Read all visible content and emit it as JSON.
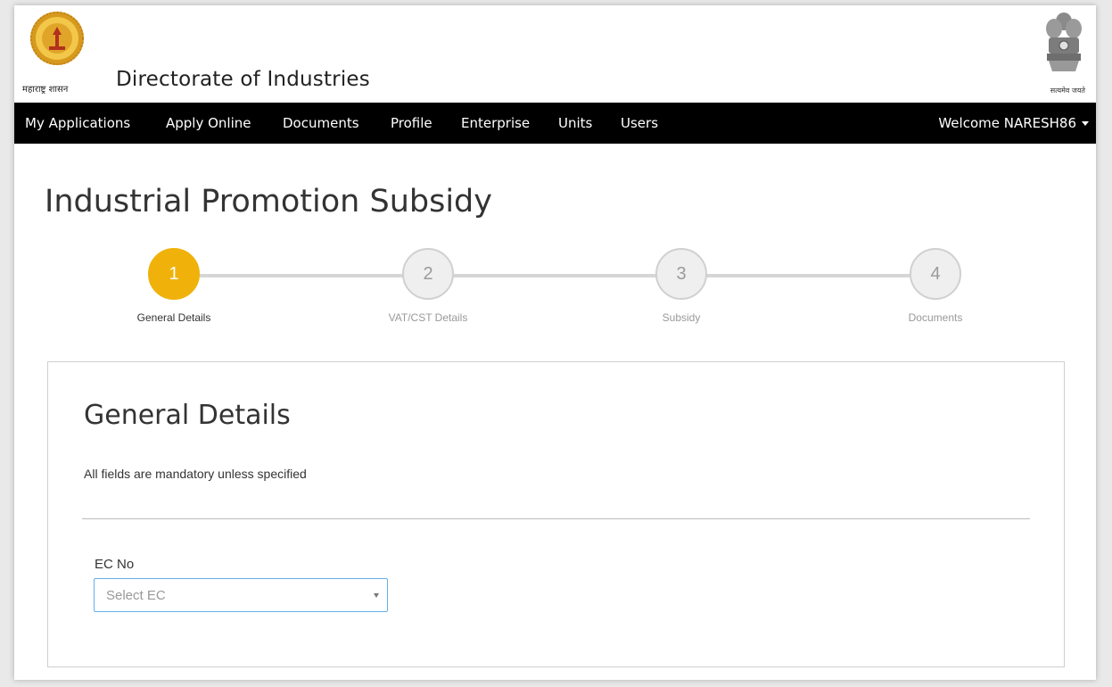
{
  "header": {
    "logo_caption": "महाराष्ट्र शासन",
    "site_title": "Directorate of Industries",
    "emblem_caption": "सत्यमेव जयते"
  },
  "nav": {
    "items": [
      {
        "label": "My Applications"
      },
      {
        "label": "Apply Online"
      },
      {
        "label": "Documents"
      },
      {
        "label": "Profile"
      },
      {
        "label": "Enterprise"
      },
      {
        "label": "Units"
      },
      {
        "label": "Users"
      }
    ],
    "welcome": "Welcome NARESH86"
  },
  "page": {
    "title": "Industrial Promotion Subsidy"
  },
  "stepper": {
    "active_step": 1,
    "steps": [
      {
        "number": "1",
        "label": "General Details"
      },
      {
        "number": "2",
        "label": "VAT/CST Details"
      },
      {
        "number": "3",
        "label": "Subsidy"
      },
      {
        "number": "4",
        "label": "Documents"
      }
    ]
  },
  "form": {
    "title": "General Details",
    "note": "All fields are mandatory unless specified",
    "ec_label": "EC No",
    "ec_placeholder": "Select EC"
  },
  "colors": {
    "nav_bg": "#000000",
    "active_step": "#f0b20a",
    "inactive_step": "#efefef",
    "focus_border": "#66afe9"
  },
  "icons": {
    "logo": "maharashtra-seal-icon",
    "emblem": "ashoka-emblem-icon",
    "caret": "caret-down-icon"
  }
}
